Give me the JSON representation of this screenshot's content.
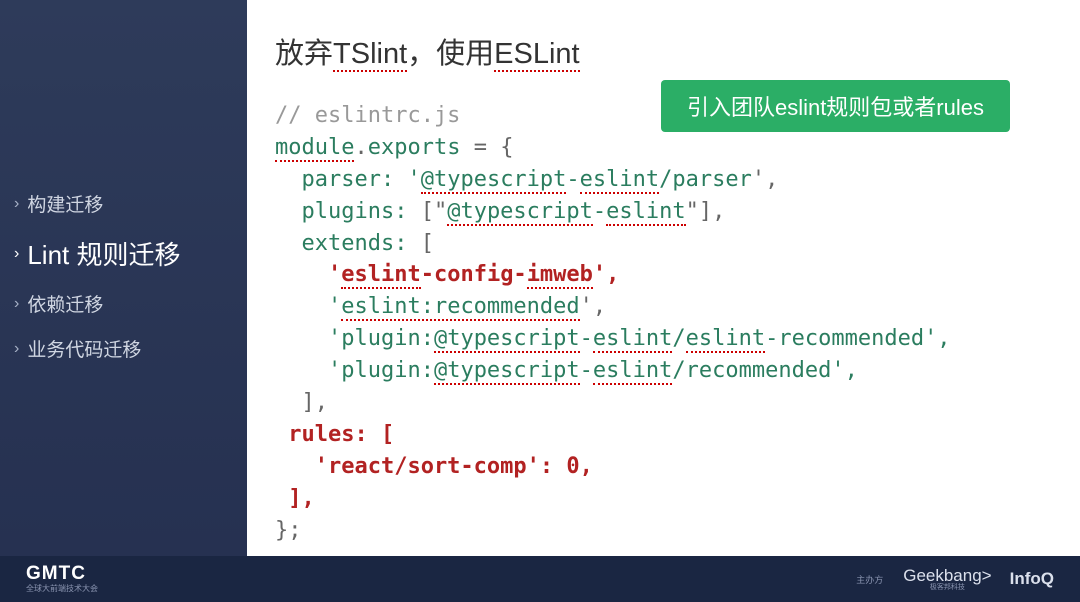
{
  "sidebar": {
    "items": [
      {
        "label": "构建迁移",
        "active": false
      },
      {
        "label": "Lint 规则迁移",
        "active": true
      },
      {
        "label": "依赖迁移",
        "active": false
      },
      {
        "label": "业务代码迁移",
        "active": false
      }
    ]
  },
  "main": {
    "title_prefix": "放弃",
    "title_underline1": "TSlint",
    "title_mid": "，使用",
    "title_underline2": "ESLint",
    "callout": "引入团队eslint规则包或者rules"
  },
  "code": {
    "c1": "// eslintrc.js",
    "module": "module",
    "dot": ".",
    "exports": "exports",
    "eq": " = {",
    "parser_key": "  parser:",
    "parser_val_open": " '",
    "parser_val_at": "@typescript",
    "parser_val_dash": "-",
    "parser_val_eslint": "eslint",
    "parser_val_rest": "/parser",
    "parser_val_close": "',",
    "plugins_key": "  plugins:",
    "plugins_val_open": " [\"",
    "plugins_at": "@typescript",
    "plugins_dash": "-",
    "plugins_eslint": "eslint",
    "plugins_close": "\"],",
    "extends_key": "  extends:",
    "extends_open": " [",
    "ext1_indent": "    ",
    "ext1_q": "'",
    "ext1_a": "eslint",
    "ext1_d1": "-config-",
    "ext1_b": "imweb",
    "ext1_end": "',",
    "ext2_indent": "    ",
    "ext2_q": "'",
    "ext2_a": "eslint:recommended",
    "ext2_end": "',",
    "ext3_indent": "    ",
    "ext3_q": "'plugin:",
    "ext3_a": "@typescript",
    "ext3_d": "-",
    "ext3_b": "eslint",
    "ext3_s": "/",
    "ext3_c": "eslint",
    "ext3_rest": "-recommended',",
    "ext4_indent": "    ",
    "ext4_q": "'plugin:",
    "ext4_a": "@typescript",
    "ext4_d": "-",
    "ext4_b": "eslint",
    "ext4_rest": "/recommended',",
    "extends_close": "  ],",
    "rules_key": " rules: [",
    "rules_line": "   'react/sort-comp': 0,",
    "rules_close": " ],",
    "end": "};"
  },
  "footer": {
    "logo": "GMTC",
    "sub": "全球大前端技术大会",
    "sponsor_label": "主办方",
    "sponsor1": "Geekbang>",
    "sponsor1_sub": "极客邦科技",
    "sponsor2": "InfoQ"
  }
}
